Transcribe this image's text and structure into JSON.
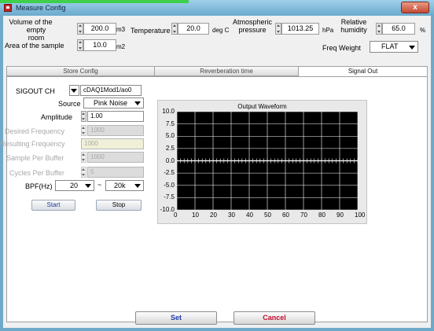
{
  "window": {
    "title": "Measure Config",
    "close_label": "x"
  },
  "params": {
    "volume": {
      "label_line1": "Volume of the",
      "label_line2": "empty room",
      "value": "200.0",
      "unit": "m3"
    },
    "area": {
      "label": "Area of the sample",
      "value": "10.0",
      "unit": "m2"
    },
    "temperature": {
      "label": "Temperature",
      "value": "20.0",
      "unit": "deg C"
    },
    "pressure": {
      "label_line1": "Atmospheric",
      "label_line2": "pressure",
      "value": "1013.25",
      "unit": "hPa"
    },
    "humidity": {
      "label_line1": "Relative",
      "label_line2": "humidity",
      "value": "65.0",
      "unit": "%"
    },
    "freq_weight": {
      "label": "Freq Weight",
      "value": "FLAT"
    }
  },
  "tabs": [
    {
      "label": "Store Config"
    },
    {
      "label": "Reverberation time"
    },
    {
      "label": "Signal Out"
    }
  ],
  "signal_out": {
    "sigout_ch": {
      "label": "SIGOUT CH",
      "value": "cDAQ1Mod1/ao0"
    },
    "source": {
      "label": "Source",
      "value": "Pink Noise"
    },
    "amplitude": {
      "label": "Amplitude",
      "value": "1.00"
    },
    "desired_freq": {
      "label": "Desired Frequency",
      "value": "1000"
    },
    "resulting_freq": {
      "label": "Resulting Frequency",
      "value": "1000"
    },
    "sample_per_buffer": {
      "label": "Sample Per Buffer",
      "value": "1000"
    },
    "cycles_per_buffer": {
      "label": "Cycles Per Buffer",
      "value": "5"
    },
    "bpf": {
      "label": "BPF(Hz)",
      "low": "20",
      "separator": "~",
      "high": "20k"
    },
    "start_label": "Start",
    "stop_label": "Stop"
  },
  "chart_data": {
    "type": "line",
    "title": "Output Waveform",
    "xlabel": "",
    "ylabel": "",
    "xlim": [
      0,
      100
    ],
    "ylim": [
      -10.0,
      10.0
    ],
    "x_ticks": [
      "0",
      "10",
      "20",
      "30",
      "40",
      "50",
      "60",
      "70",
      "80",
      "90",
      "100"
    ],
    "y_ticks": [
      "10.0",
      "7.5",
      "5.0",
      "2.5",
      "0.0",
      "-2.5",
      "-5.0",
      "-7.5",
      "-10.0"
    ],
    "grid": true,
    "background": "#000000",
    "grid_color": "#ffffff",
    "series": [
      {
        "x": [
          0,
          100
        ],
        "y": [
          0.0,
          0.0
        ]
      }
    ]
  },
  "footer": {
    "set_label": "Set",
    "cancel_label": "Cancel",
    "set_color": "#1f3fa8",
    "cancel_color": "#c8102e"
  }
}
